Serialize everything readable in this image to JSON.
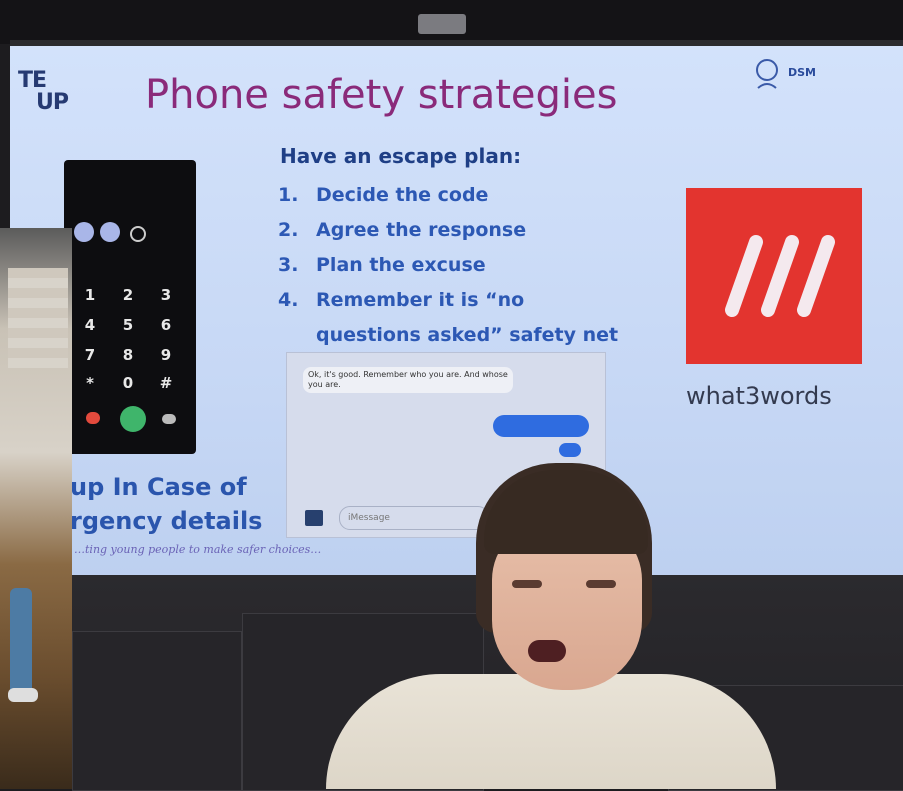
{
  "slide": {
    "title": "Phone safety strategies",
    "logo_left": {
      "line1": "TE",
      "line2": "UP"
    },
    "logo_right": {
      "brand": "DSM",
      "sub": ""
    },
    "heading": "Have an escape plan:",
    "steps": [
      {
        "num": "1.",
        "text": "Decide the code"
      },
      {
        "num": "2.",
        "text": "Agree the response"
      },
      {
        "num": "3.",
        "text": "Plan the excuse"
      },
      {
        "num": "4.",
        "text": "Remember it is “no",
        "cont": "questions asked” safety net"
      }
    ],
    "chat": {
      "incoming": "Ok, it's good. Remember who you are. And whose you are.",
      "reply": "",
      "input_placeholder": "iMessage"
    },
    "w3w_text": "what3words",
    "partial_text": {
      "line1": "up In Case of",
      "line2": "rgency details"
    },
    "footer": "…ting young people to make safer choices…"
  },
  "colors": {
    "title": "#8a2a7a",
    "heading": "#1f3f86",
    "steps": "#2c58b4",
    "w3w_red": "#e3342f"
  }
}
